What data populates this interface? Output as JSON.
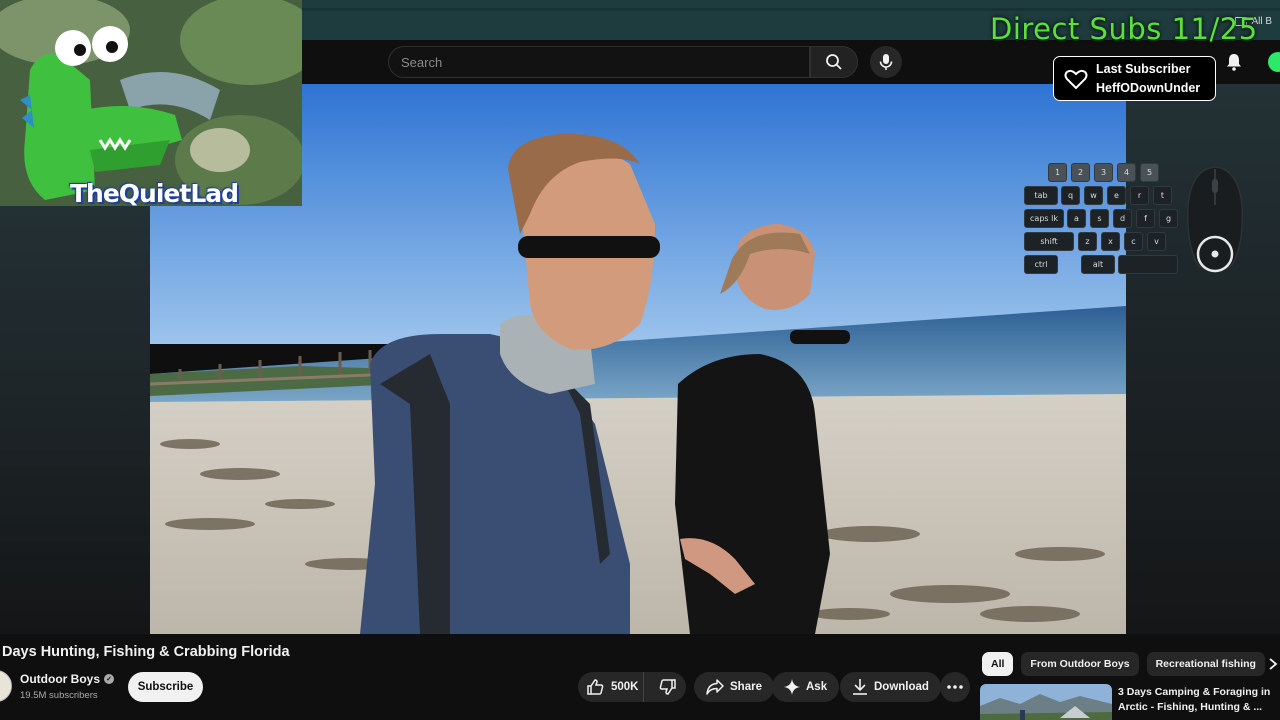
{
  "browser": {
    "bookmarks_label": "All B"
  },
  "header": {
    "search_placeholder": "Search"
  },
  "overlay": {
    "subs_counter": "Direct Subs 11/25",
    "last_subscriber_label": "Last Subscriber",
    "last_subscriber_name": "HeffODownUnder",
    "webcam_logo_text": "TheQuietLad",
    "keyboard": {
      "row1": [
        "1",
        "2",
        "3",
        "4",
        "5"
      ],
      "row2": [
        "tab",
        "q",
        "w",
        "e",
        "r",
        "t"
      ],
      "row3": [
        "caps lk",
        "a",
        "s",
        "d",
        "f",
        "g"
      ],
      "row4": [
        "shift",
        "z",
        "x",
        "c",
        "v"
      ],
      "row5": [
        "ctrl",
        "alt"
      ]
    }
  },
  "video": {
    "title": "Days Hunting, Fishing & Crabbing Florida",
    "channel_name": "Outdoor Boys",
    "subscribers": "19.5M subscribers",
    "subscribe_label": "Subscribe",
    "likes": "500K",
    "share_label": "Share",
    "ask_label": "Ask",
    "download_label": "Download"
  },
  "sidebar": {
    "chips": [
      "All",
      "From Outdoor Boys",
      "Recreational fishing"
    ],
    "recommendation_title": "3 Days Camping & Foraging in Arctic - Fishing, Hunting & ..."
  },
  "colors": {
    "subs_counter": "#5be03c",
    "background": "#0f0f0f",
    "sky": "#3f86d8"
  }
}
